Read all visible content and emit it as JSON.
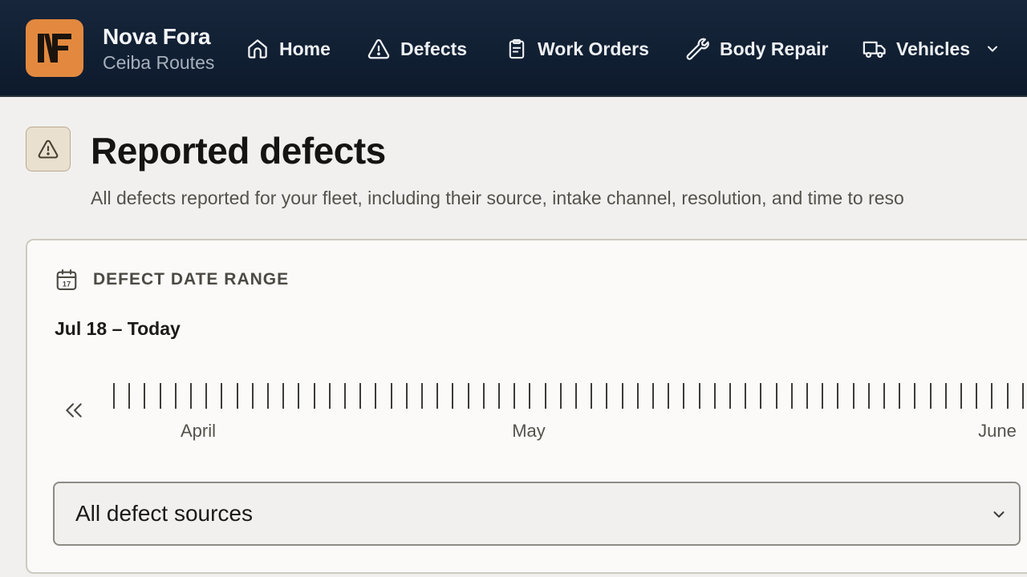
{
  "app": {
    "logo_text": "NF",
    "name": "Nova Fora",
    "subtitle": "Ceiba Routes"
  },
  "nav": {
    "items": [
      {
        "label": "Home",
        "icon": "home-icon"
      },
      {
        "label": "Defects",
        "icon": "warning-triangle-icon"
      },
      {
        "label": "Work Orders",
        "icon": "clipboard-icon"
      },
      {
        "label": "Body Repair",
        "icon": "wrench-icon"
      },
      {
        "label": "Vehicles",
        "icon": "truck-icon",
        "has_dropdown": true
      }
    ]
  },
  "page": {
    "icon": "warning-triangle-icon",
    "title": "Reported defects",
    "description": "All defects reported for your fleet, including their source, intake channel, resolution, and time to reso"
  },
  "date_range": {
    "icon": "calendar-icon",
    "calendar_day": "17",
    "label": "DEFECT DATE RANGE",
    "value": "Jul 18 – Today",
    "prev_icon": "double-chevron-left-icon",
    "months": [
      "April",
      "May",
      "June"
    ]
  },
  "source_select": {
    "selected": "All defect sources",
    "icon": "chevron-down-icon"
  },
  "colors": {
    "nav_background": "#0f1d31",
    "logo_background": "#e2893f",
    "page_background": "#f1f0ee",
    "card_background": "#fbfaf8"
  }
}
